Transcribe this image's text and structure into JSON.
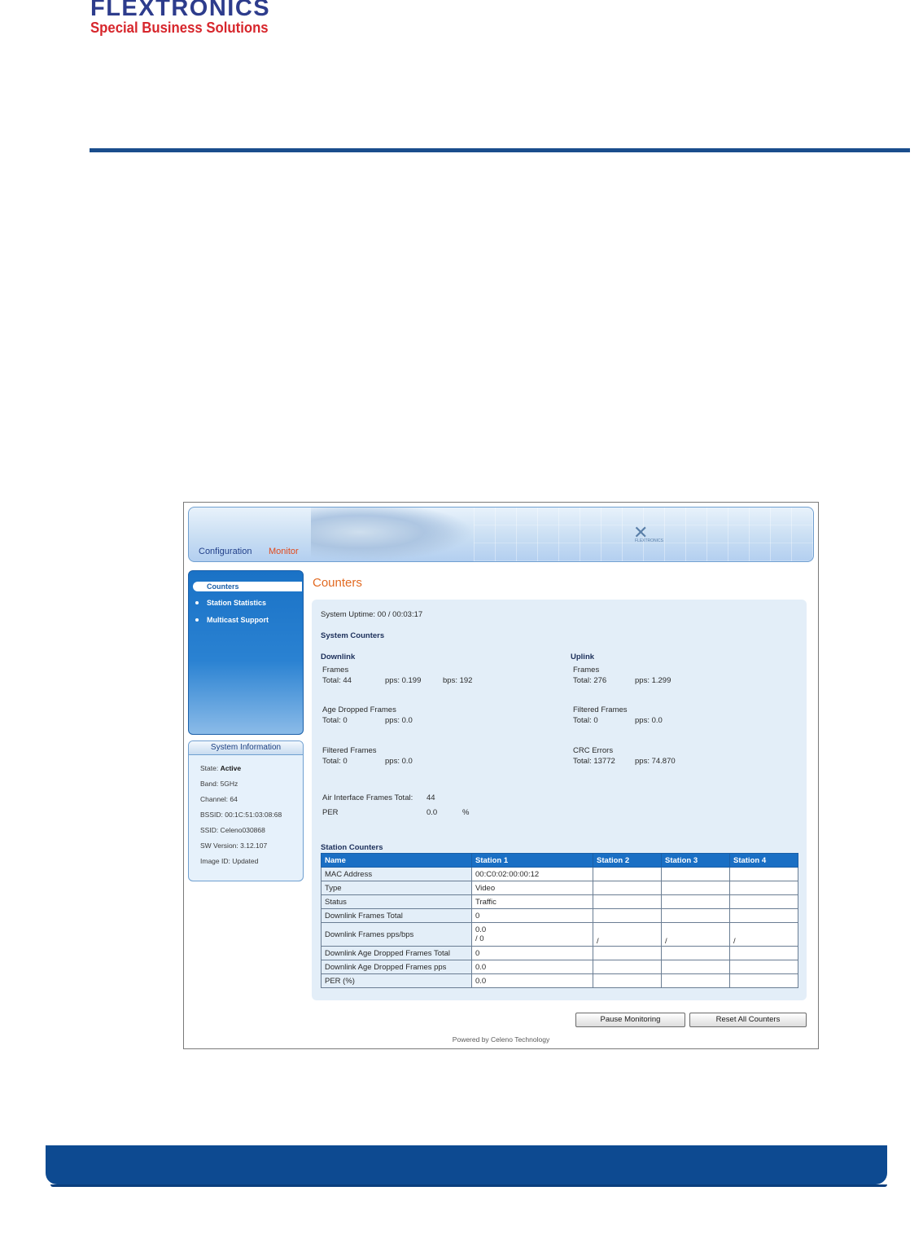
{
  "document": {
    "logo_main": "FLEXTRONICS",
    "logo_sub": "Special Business Solutions",
    "rule_color": "#1a4d8c",
    "footer_color": "#0d4a91"
  },
  "app": {
    "nav": {
      "configuration": "Configuration",
      "monitor": "Monitor"
    },
    "sidebar": {
      "items": [
        {
          "label": "Counters",
          "active": true
        },
        {
          "label": "Station Statistics",
          "active": false
        },
        {
          "label": "Multicast Support",
          "active": false
        }
      ]
    },
    "system_information": {
      "title": "System Information",
      "state_label": "State:",
      "state_value": "Active",
      "band": "Band: 5GHz",
      "channel": "Channel: 64",
      "bssid": "BSSID: 00:1C:51:03:08:68",
      "ssid": "SSID: Celeno030868",
      "sw_version": "SW Version: 3.12.107",
      "image_id": "Image ID: Updated"
    },
    "page_title": "Counters",
    "uptime": "System Uptime: 00 / 00:03:17",
    "system_counters_title": "System Counters",
    "downlink": {
      "title": "Downlink",
      "frames_label": "Frames",
      "frames_total": "Total: 44",
      "frames_pps": "pps: 0.199",
      "frames_bps": "bps: 192",
      "age_dropped_label": "Age Dropped Frames",
      "age_dropped_total": "Total: 0",
      "age_dropped_pps": "pps: 0.0",
      "filtered_label": "Filtered Frames",
      "filtered_total": "Total: 0",
      "filtered_pps": "pps: 0.0"
    },
    "uplink": {
      "title": "Uplink",
      "frames_label": "Frames",
      "frames_total": "Total: 276",
      "frames_pps": "pps: 1.299",
      "filtered_label": "Filtered Frames",
      "filtered_total": "Total: 0",
      "filtered_pps": "pps: 0.0",
      "crc_label": "CRC Errors",
      "crc_total": "Total: 13772",
      "crc_pps": "pps: 74.870"
    },
    "air_interface": {
      "label": "Air Interface Frames Total:",
      "value": "44"
    },
    "per": {
      "label": "PER",
      "value": "0.0",
      "unit": "%"
    },
    "station_counters": {
      "title": "Station Counters",
      "headers": [
        "Name",
        "Station 1",
        "Station 2",
        "Station 3",
        "Station 4"
      ],
      "rows": [
        {
          "name": "MAC Address",
          "s1": "00:C0:02:00:00:12",
          "s2": "",
          "s3": "",
          "s4": ""
        },
        {
          "name": "Type",
          "s1": "Video",
          "s2": "",
          "s3": "",
          "s4": ""
        },
        {
          "name": "Status",
          "s1": "Traffic",
          "s2": "",
          "s3": "",
          "s4": ""
        },
        {
          "name": "Downlink Frames Total",
          "s1": "0",
          "s2": "",
          "s3": "",
          "s4": ""
        },
        {
          "name": "Downlink Frames pps/bps",
          "s1_top": "0.0",
          "s1_bottom": "/ 0",
          "s2": "/",
          "s3": "/",
          "s4": "/"
        },
        {
          "name": "Downlink Age Dropped Frames Total",
          "s1": "0",
          "s2": "",
          "s3": "",
          "s4": ""
        },
        {
          "name": "Downlink Age Dropped Frames pps",
          "s1": "0.0",
          "s2": "",
          "s3": "",
          "s4": ""
        },
        {
          "name": "PER (%)",
          "s1": "0.0",
          "s2": "",
          "s3": "",
          "s4": ""
        }
      ]
    },
    "buttons": {
      "pause": "Pause Monitoring",
      "reset": "Reset All Counters"
    },
    "powered_by": "Powered by Celeno Technology",
    "banner_logo_text": "FLEXTRONICS"
  }
}
